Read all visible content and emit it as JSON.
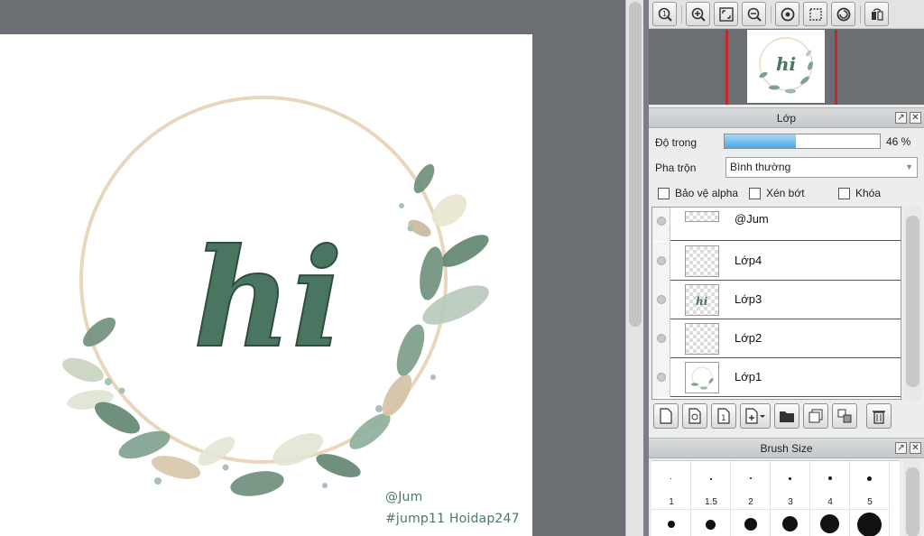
{
  "canvas": {
    "artwork_text": "hi",
    "signature_line1": "@Jum",
    "signature_line2": "#jump11 Hoidap247"
  },
  "navigator_toolbar": {
    "icons": [
      "zoom-actual-icon",
      "zoom-in-icon",
      "fit-window-icon",
      "zoom-out-icon",
      "rotate-left-icon",
      "fit-canvas-icon",
      "rotate-right-icon",
      "flip-icon"
    ]
  },
  "layer_panel": {
    "title": "Lớp",
    "opacity_label": "Độ trong",
    "opacity_value": 46,
    "opacity_text": "46 %",
    "blend_label": "Pha trộn",
    "blend_value": "Bình thường",
    "checkboxes": [
      {
        "label": "Bảo vệ alpha",
        "checked": false
      },
      {
        "label": "Xén bớt",
        "checked": false
      },
      {
        "label": "Khóa",
        "checked": false
      }
    ],
    "layers": [
      {
        "name": "@Jum"
      },
      {
        "name": "Lớp4"
      },
      {
        "name": "Lớp3"
      },
      {
        "name": "Lớp2"
      },
      {
        "name": "Lớp1"
      }
    ],
    "toolbar_icons": [
      "new-layer-icon",
      "new-layer-copy-icon",
      "one-layer-icon",
      "add-layer-dropdown-icon",
      "folder-icon",
      "duplicate-icon",
      "merge-icon",
      "trash-icon"
    ]
  },
  "brush_panel": {
    "title": "Brush Size",
    "sizes": [
      "1",
      "1.5",
      "2",
      "3",
      "4",
      "5"
    ]
  },
  "colors": {
    "ink": "#3f6b56",
    "leaf_light": "#b8c9b5",
    "hoop": "#e2ccad",
    "accent_red": "#c8262b",
    "opacity_fill": "#4aa8e8"
  }
}
